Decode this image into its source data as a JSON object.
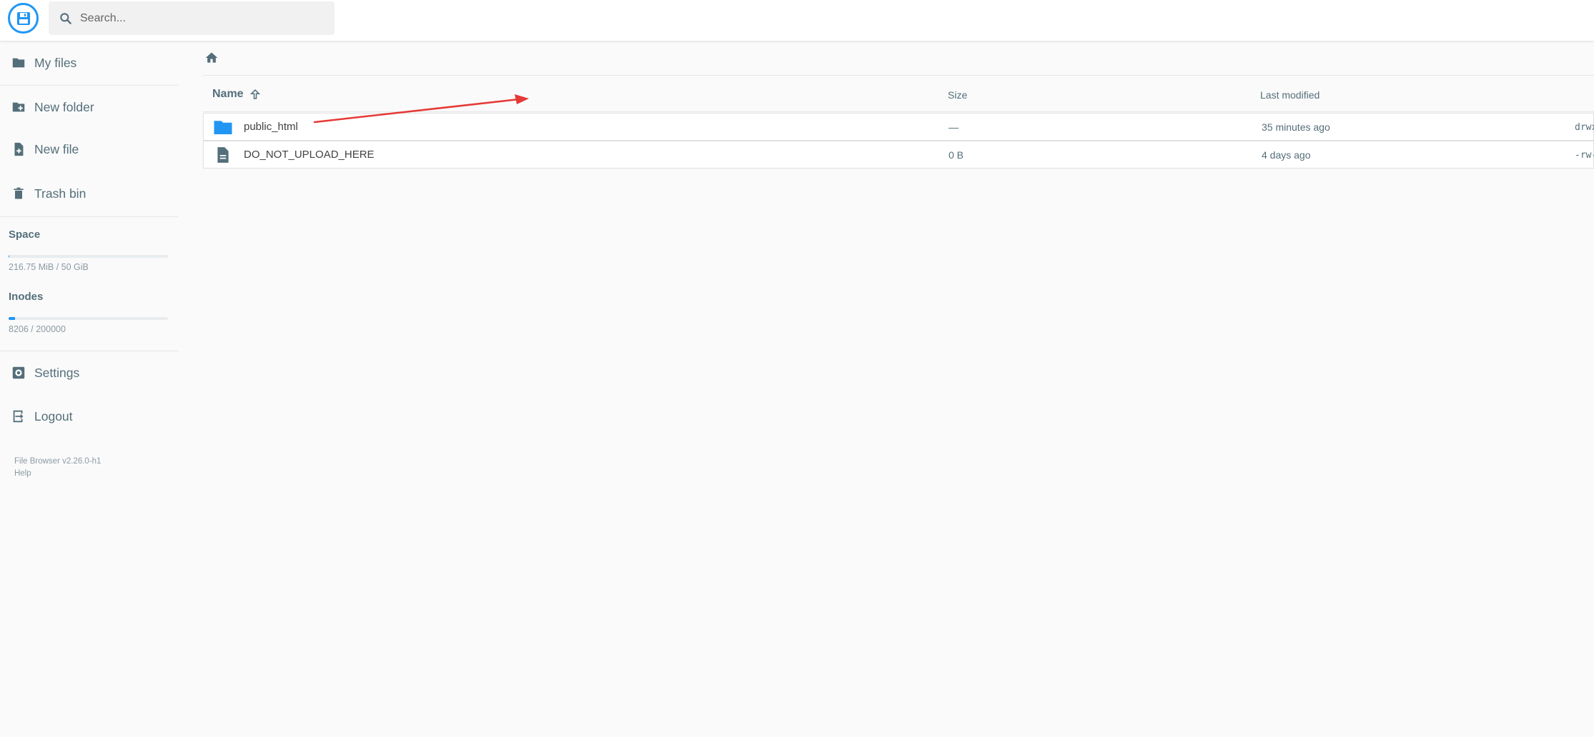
{
  "header": {
    "logo_icon": "floppy-disk-icon",
    "search": {
      "placeholder": "Search...",
      "value": ""
    }
  },
  "sidebar": {
    "items": [
      {
        "label": "My files",
        "icon": "folder-icon"
      },
      {
        "label": "New folder",
        "icon": "create-new-folder-icon"
      },
      {
        "label": "New file",
        "icon": "note-add-icon"
      },
      {
        "label": "Trash bin",
        "icon": "trash-icon"
      }
    ],
    "space": {
      "title": "Space",
      "text": "216.75 MiB / 50 GiB",
      "fraction": 0.0042
    },
    "inodes": {
      "title": "Inodes",
      "text": "8206 / 200000",
      "fraction": 0.041
    },
    "settings_label": "Settings",
    "logout_label": "Logout",
    "credits": {
      "version": "File Browser v2.26.0-h1",
      "help": "Help"
    }
  },
  "breadcrumbs": {
    "home_icon": "home-icon"
  },
  "listing": {
    "columns": {
      "name": "Name",
      "size": "Size",
      "modified": "Last modified"
    },
    "sort_icon": "arrow-upward-icon",
    "rows": [
      {
        "name": "public_html",
        "size": "—",
        "modified": "35 minutes ago",
        "permissions": "drwx",
        "icon": "folder-icon"
      },
      {
        "name": "DO_NOT_UPLOAD_HERE",
        "size": "0 B",
        "modified": "4 days ago",
        "permissions": "-rw-",
        "icon": "file-icon"
      }
    ]
  },
  "colors": {
    "accent": "#2196f3",
    "nav_text": "#546e7a",
    "annotation_arrow": "#e53935"
  }
}
